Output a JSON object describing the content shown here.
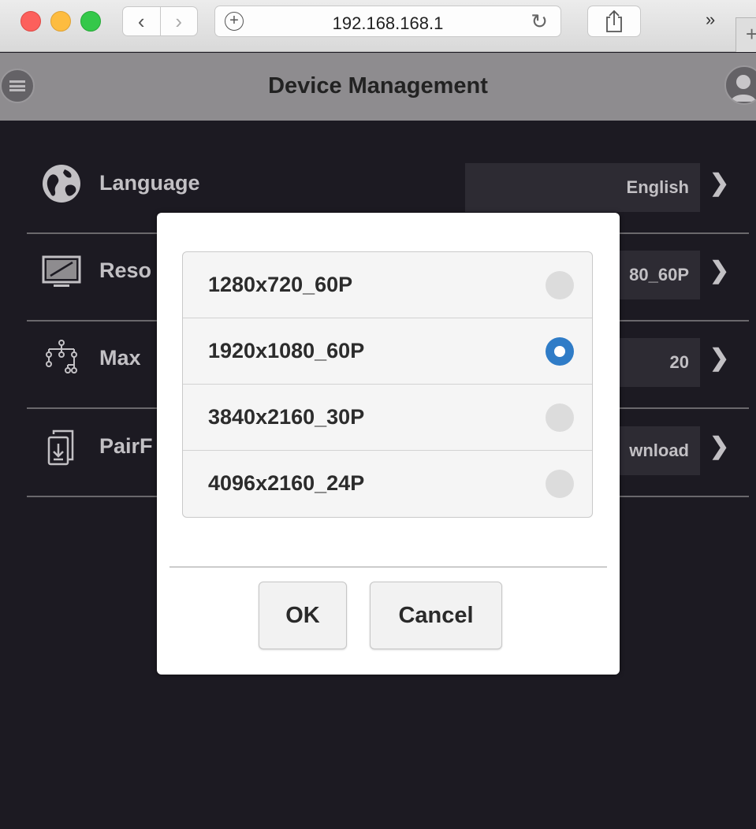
{
  "browser": {
    "back_icon": "chevron-left",
    "forward_icon": "chevron-right",
    "url": "192.168.168.1",
    "more_label": "»",
    "new_tab_label": "+"
  },
  "header": {
    "title": "Device Management"
  },
  "settings": [
    {
      "label": "Language",
      "value": "English",
      "icon": "globe-icon"
    },
    {
      "label": "Reso",
      "value": "80_60P",
      "icon": "monitor-icon"
    },
    {
      "label": "Max",
      "value": "20",
      "icon": "tree-icon"
    },
    {
      "label": "PairF",
      "value": "wnload",
      "icon": "download-doc-icon"
    }
  ],
  "dialog": {
    "options": [
      {
        "label": "1280x720_60P",
        "selected": false
      },
      {
        "label": "1920x1080_60P",
        "selected": true
      },
      {
        "label": "3840x2160_30P",
        "selected": false
      },
      {
        "label": "4096x2160_24P",
        "selected": false
      }
    ],
    "ok_label": "OK",
    "cancel_label": "Cancel"
  },
  "colors": {
    "page_bg": "#1c1a22",
    "header_bg": "#8e8c8f",
    "radio_selected": "#2f7cc7",
    "radio_unselected": "#dcdcdc"
  }
}
